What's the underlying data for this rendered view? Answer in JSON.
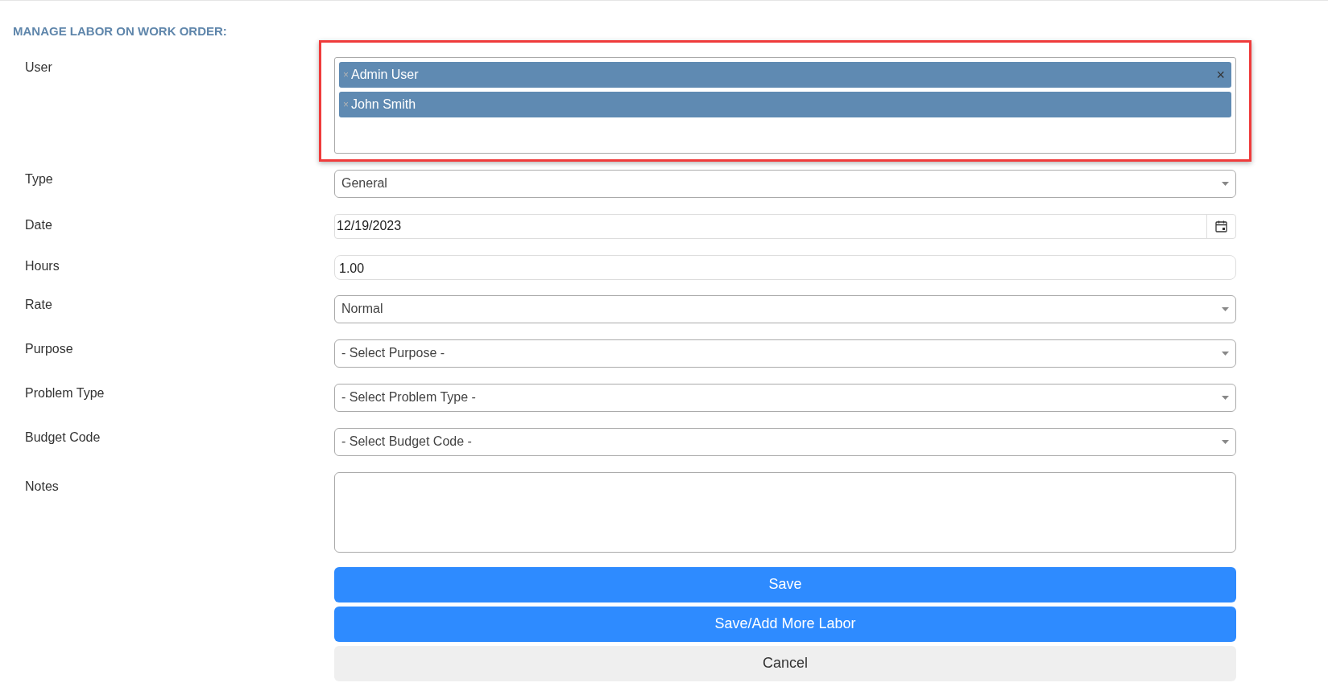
{
  "heading": "MANAGE LABOR ON WORK ORDER:",
  "fields": [
    {
      "kind": "tags",
      "label": "User",
      "highlighted": true,
      "tags": [
        "Admin User",
        "John Smith"
      ],
      "clear": "×",
      "remove": "×"
    },
    {
      "kind": "select",
      "label": "Type",
      "value": "General"
    },
    {
      "kind": "date",
      "label": "Date",
      "value": "12/19/2023"
    },
    {
      "kind": "text",
      "label": "Hours",
      "value": "1.00"
    },
    {
      "kind": "select",
      "label": "Rate",
      "value": "Normal"
    },
    {
      "kind": "select",
      "label": "Purpose",
      "value": "- Select Purpose -"
    },
    {
      "kind": "select",
      "label": "Problem Type",
      "value": "- Select Problem Type -"
    },
    {
      "kind": "select",
      "label": "Budget Code",
      "value": "- Select Budget Code -"
    },
    {
      "kind": "textarea",
      "label": "Notes"
    }
  ],
  "buttons": [
    {
      "label": "Save",
      "kind": "primary"
    },
    {
      "label": "Save/Add More Labor",
      "kind": "primary"
    },
    {
      "label": "Cancel",
      "kind": "secondary"
    }
  ]
}
